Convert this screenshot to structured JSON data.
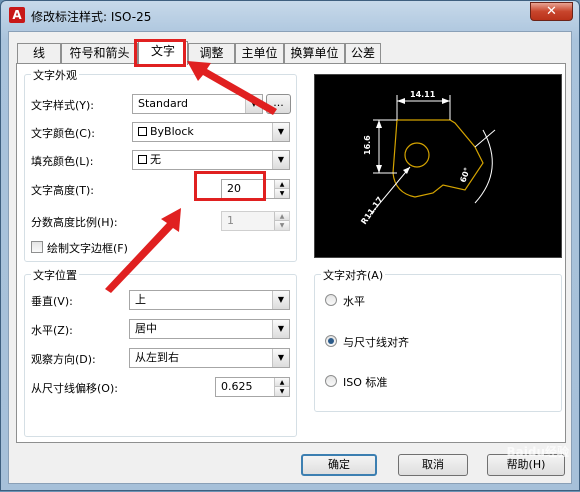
{
  "window": {
    "icon_letter": "A",
    "title": "修改标注样式: ISO-25",
    "close_glyph": "✕"
  },
  "tabs": [
    {
      "label": "线",
      "active": false
    },
    {
      "label": "符号和箭头",
      "active": false
    },
    {
      "label": "文字",
      "active": true
    },
    {
      "label": "调整",
      "active": false
    },
    {
      "label": "主单位",
      "active": false
    },
    {
      "label": "换算单位",
      "active": false
    },
    {
      "label": "公差",
      "active": false
    }
  ],
  "text_appearance": {
    "title": "文字外观",
    "style_label": "文字样式(Y):",
    "style_value": "Standard",
    "style_button": "...",
    "color_label": "文字颜色(C):",
    "color_value": "ByBlock",
    "fill_label": "填充颜色(L):",
    "fill_value": "无",
    "height_label": "文字高度(T):",
    "height_value": "20",
    "fraction_label": "分数高度比例(H):",
    "fraction_value": "1",
    "frame_label": "绘制文字边框(F)"
  },
  "text_placement": {
    "title": "文字位置",
    "vertical_label": "垂直(V):",
    "vertical_value": "上",
    "horizontal_label": "水平(Z):",
    "horizontal_value": "居中",
    "view_label": "观察方向(D):",
    "view_value": "从左到右",
    "offset_label": "从尺寸线偏移(O):",
    "offset_value": "0.625"
  },
  "text_alignment": {
    "title": "文字对齐(A)",
    "options": [
      {
        "label": "水平",
        "selected": false
      },
      {
        "label": "与尺寸线对齐",
        "selected": true
      },
      {
        "label": "ISO 标准",
        "selected": false
      }
    ]
  },
  "preview": {
    "dim_top": "14.11",
    "dim_left": "16.6",
    "dim_bottom": "R11.17",
    "dim_angle": "60°"
  },
  "buttons": {
    "ok": "确定",
    "cancel": "取消",
    "help": "帮助(H)"
  },
  "watermark": "Baidu经验",
  "colors": {
    "annotation_red": "#e02020",
    "preview_bg": "#000000",
    "preview_part": "#d4a300"
  }
}
